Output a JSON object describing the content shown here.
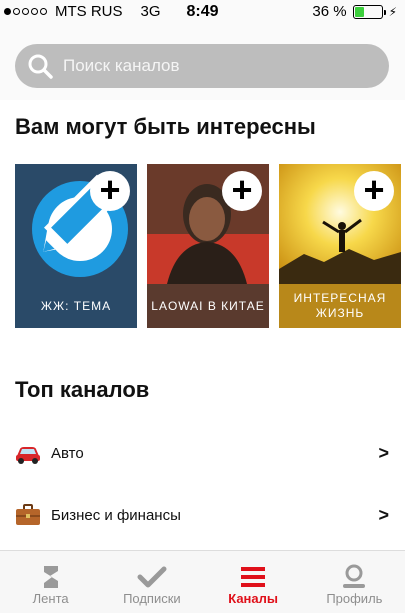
{
  "status_bar": {
    "carrier": "MTS RUS",
    "network": "3G",
    "time": "8:49",
    "battery_percent_label": "36 %",
    "battery_level": 0.36
  },
  "search": {
    "placeholder": "Поиск каналов"
  },
  "recommend": {
    "title": "Вам могут быть интересны",
    "cards": [
      {
        "label": "ЖЖ: ТЕМА",
        "bg": "#2a4a68"
      },
      {
        "label": "LAOWAI В КИТАЕ",
        "bg": "#5a3a2e"
      },
      {
        "label": "ИНТЕРЕСНАЯ ЖИЗНЬ",
        "bg": "#b8881a"
      }
    ]
  },
  "top": {
    "title": "Топ каналов",
    "rows": [
      {
        "label": "Авто",
        "icon": "car-icon"
      },
      {
        "label": "Бизнес и финансы",
        "icon": "briefcase-icon"
      }
    ]
  },
  "tabbar": {
    "tabs": [
      {
        "label": "Лента",
        "icon": "feed-icon"
      },
      {
        "label": "Подписки",
        "icon": "check-icon"
      },
      {
        "label": "Каналы",
        "icon": "channels-icon",
        "active": true
      },
      {
        "label": "Профиль",
        "icon": "profile-icon"
      }
    ],
    "accent": "#e0101a"
  }
}
